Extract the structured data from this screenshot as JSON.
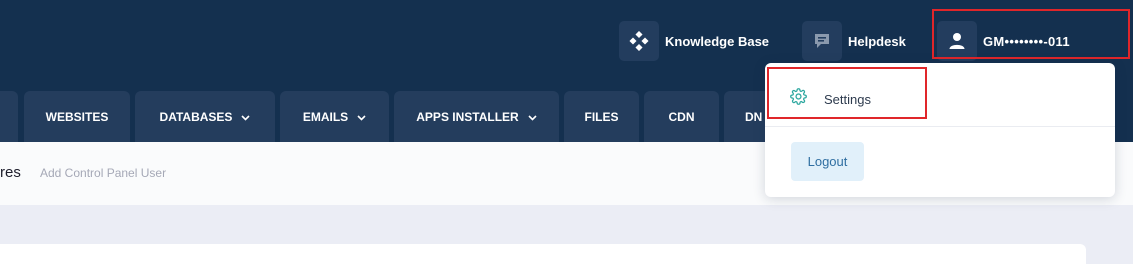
{
  "header": {
    "knowledge_base_label": "Knowledge Base",
    "helpdesk_label": "Helpdesk",
    "user_name": "GM••••••••-011"
  },
  "nav": {
    "tabs": [
      {
        "label": "",
        "has_dropdown": false
      },
      {
        "label": "WEBSITES",
        "has_dropdown": false
      },
      {
        "label": "DATABASES",
        "has_dropdown": true
      },
      {
        "label": "EMAILS",
        "has_dropdown": true
      },
      {
        "label": "APPS INSTALLER",
        "has_dropdown": true
      },
      {
        "label": "FILES",
        "has_dropdown": false
      },
      {
        "label": "CDN",
        "has_dropdown": false
      },
      {
        "label": "DN",
        "has_dropdown": false
      }
    ]
  },
  "page": {
    "title_fragment": "res",
    "subtitle": "Add Control Panel User"
  },
  "user_menu": {
    "settings_label": "Settings",
    "logout_label": "Logout"
  },
  "colors": {
    "header_bg": "#14304f",
    "tab_bg": "#243d5d",
    "highlight": "#e0262a",
    "settings_icon": "#2fa8a0",
    "logout_bg": "#e1f0fa"
  },
  "icons": {
    "knowledge_base": "diamond-grid-icon",
    "helpdesk": "chat-bubble-icon",
    "user": "user-icon",
    "settings": "gear-icon",
    "tab_dropdown": "chevron-down-icon"
  }
}
